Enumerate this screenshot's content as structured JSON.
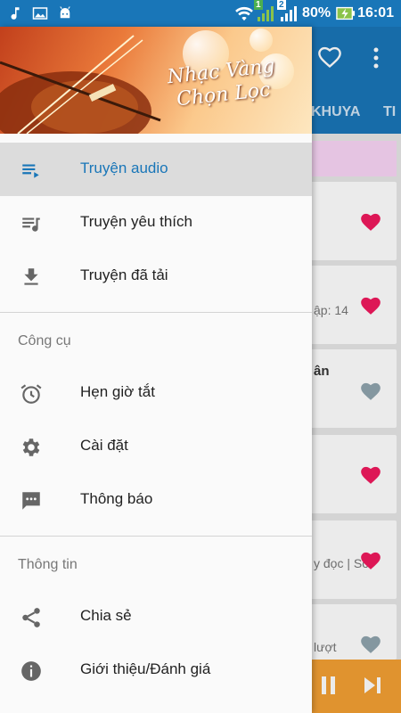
{
  "status_bar": {
    "battery": "80%",
    "time": "16:01",
    "sim1": "1",
    "sim2": "2"
  },
  "background_app": {
    "tabs": [
      "KHUYA",
      "TI"
    ],
    "card_texts": [
      {
        "text": "ập: 14",
        "bold": false
      },
      {
        "text": "ân",
        "bold": true
      },
      {
        "text": "y đọc | Số",
        "bold": false
      },
      {
        "text": "lượt",
        "bold": false
      }
    ]
  },
  "banner": {
    "title_line1": "Nhạc Vàng",
    "title_line2": "Chọn Lọc"
  },
  "drawer": {
    "main_items": [
      {
        "label": "Truyện audio",
        "icon": "playlist-play-icon",
        "active": true
      },
      {
        "label": "Truyện yêu thích",
        "icon": "playlist-music-icon",
        "active": false
      },
      {
        "label": "Truyện đã tải",
        "icon": "download-icon",
        "active": false
      }
    ],
    "tools_title": "Công cụ",
    "tools_items": [
      {
        "label": "Hẹn giờ tắt",
        "icon": "alarm-icon"
      },
      {
        "label": "Cài đặt",
        "icon": "gear-icon"
      },
      {
        "label": "Thông báo",
        "icon": "message-icon"
      }
    ],
    "info_title": "Thông tin",
    "info_items": [
      {
        "label": "Chia sẻ",
        "icon": "share-icon"
      },
      {
        "label": "Giới thiệu/Đánh giá",
        "icon": "info-icon"
      }
    ]
  },
  "colors": {
    "primary": "#1976b8",
    "accent_heart": "#f0195e",
    "inactive_heart": "#90a4ae",
    "player": "#f4a033",
    "pink_band": "#f9d5f6"
  }
}
